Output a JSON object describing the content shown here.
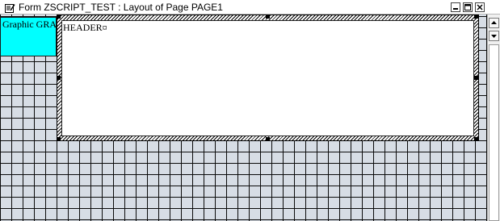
{
  "window": {
    "title": "Form ZSCRIPT_TEST : Layout of Page PAGE1",
    "icon": "edit-form-icon",
    "controls": [
      "minimize-icon",
      "maximize-icon",
      "close-icon"
    ]
  },
  "canvas": {
    "graphic_window_label": "Graphic GRAPHIC",
    "header_window_label": "HEADER¤"
  },
  "scrollbar": {
    "up_icon": "arrow-up-icon",
    "down_icon": "arrow-down-icon"
  }
}
